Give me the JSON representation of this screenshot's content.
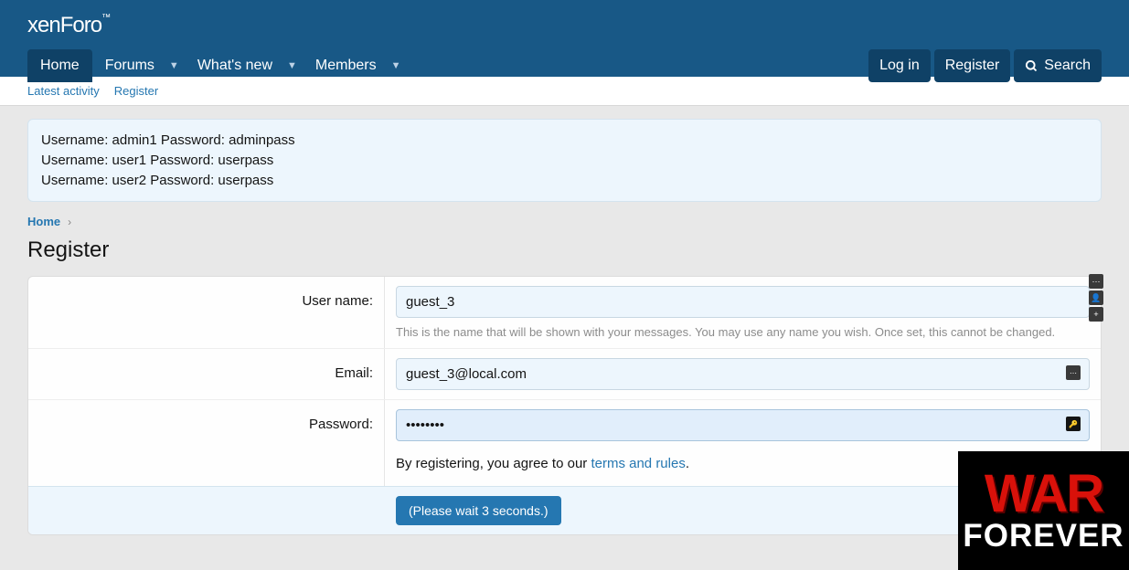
{
  "logo": {
    "part1": "xen",
    "part2": "Foro"
  },
  "nav": {
    "home": "Home",
    "forums": "Forums",
    "whatsnew": "What's new",
    "members": "Members",
    "login": "Log in",
    "register": "Register",
    "search": "Search"
  },
  "subnav": {
    "latest": "Latest activity",
    "register": "Register"
  },
  "notice": {
    "line1": "Username: admin1 Password: adminpass",
    "line2": "Username: user1 Password: userpass",
    "line3": "Username: user2 Password: userpass"
  },
  "breadcrumb": {
    "home": "Home"
  },
  "page_title": "Register",
  "form": {
    "username_label": "User name:",
    "username_value": "guest_3",
    "username_help": "This is the name that will be shown with your messages. You may use any name you wish. Once set, this cannot be changed.",
    "email_label": "Email:",
    "email_value": "guest_3@local.com",
    "password_label": "Password:",
    "password_value": "••••••••",
    "agree_prefix": "By registering, you agree to our ",
    "agree_link": "terms and rules",
    "agree_suffix": ".",
    "submit": "(Please wait 3 seconds.)"
  },
  "banner": {
    "line1": "WAR",
    "line2": "FOREVER"
  }
}
